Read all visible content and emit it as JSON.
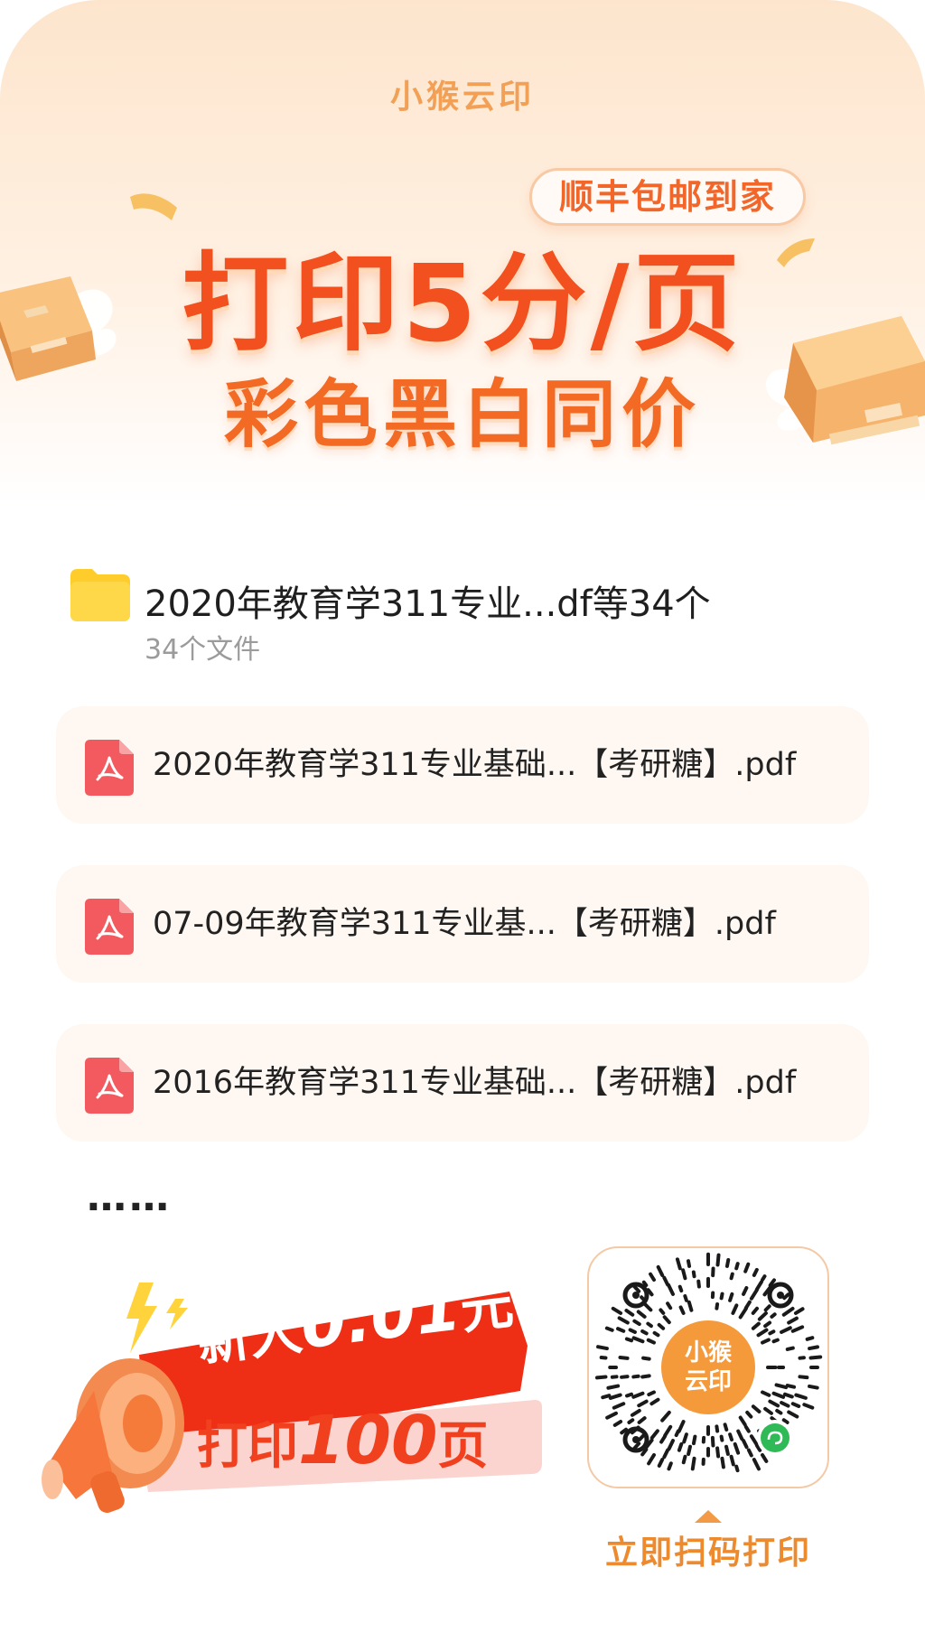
{
  "brand": {
    "name": "小猴云印"
  },
  "hero": {
    "badge": "顺丰包邮到家",
    "headline": "打印5分/页",
    "subheadline": "彩色黑白同价"
  },
  "folder": {
    "title": "2020年教育学311专业...df等34个",
    "subtitle": "34个文件"
  },
  "files": [
    {
      "name": "2020年教育学311专业基础...【考研糖】.pdf"
    },
    {
      "name": "07-09年教育学311专业基...【考研糖】.pdf"
    },
    {
      "name": "2016年教育学311专业基础...【考研糖】.pdf"
    }
  ],
  "more_indicator": "……",
  "promo": {
    "line1_prefix": "新人",
    "line1_price": "0.01",
    "line1_unit": "元",
    "line2_prefix": "打印",
    "line2_count": "100",
    "line2_unit": "页"
  },
  "qr": {
    "center_label_top": "小猴",
    "center_label_bottom": "云印",
    "caption": "立即扫码打印"
  },
  "colors": {
    "accent_orange": "#f2501e",
    "pdf_red": "#f25a5f",
    "folder_yellow": "#ffcd2b",
    "qr_center": "#f59a3a",
    "miniprogram_green": "#2fba57"
  }
}
